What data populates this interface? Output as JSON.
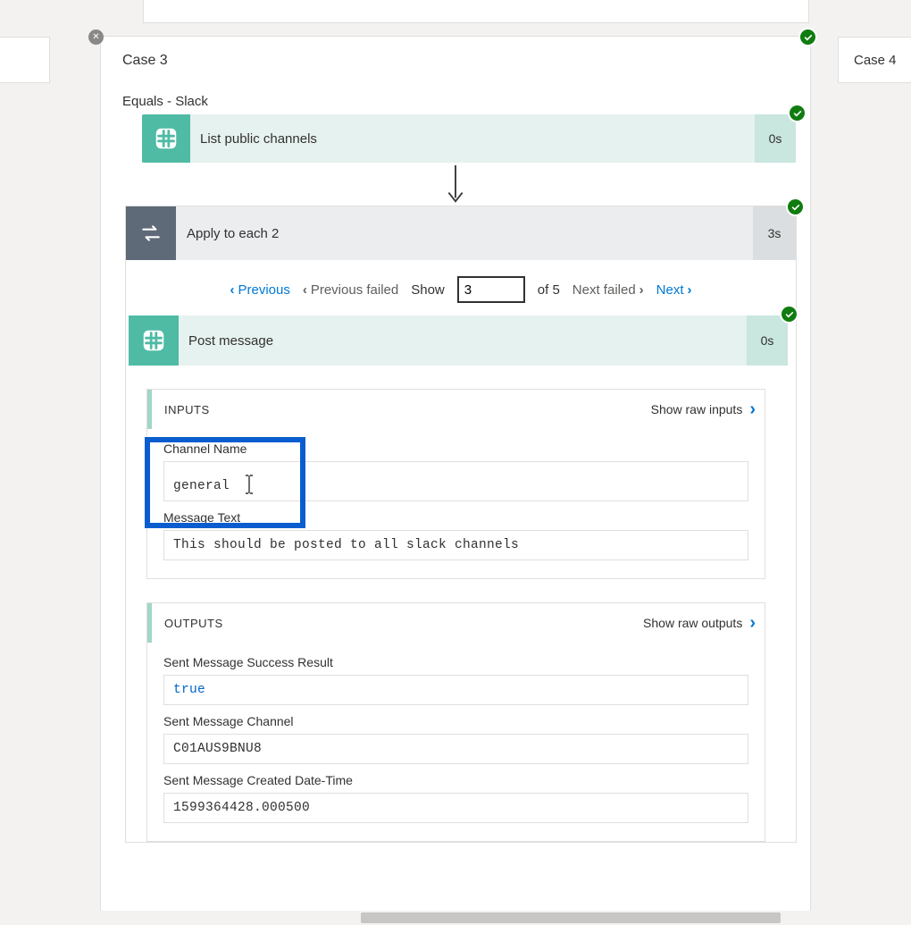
{
  "case_labels": {
    "case3": "Case 3",
    "case4": "Case 4"
  },
  "condition_label": "Equals - Slack",
  "steps": {
    "list_channels": {
      "label": "List public channels",
      "duration": "0s"
    },
    "apply_each": {
      "label": "Apply to each 2",
      "duration": "3s"
    },
    "post_message": {
      "label": "Post message",
      "duration": "0s"
    }
  },
  "pager": {
    "previous": "Previous",
    "previous_failed": "Previous failed",
    "show_label": "Show",
    "current": "3",
    "of_label": "of 5",
    "next_failed": "Next failed",
    "next": "Next"
  },
  "inputs": {
    "heading": "INPUTS",
    "raw_link": "Show raw inputs",
    "fields": {
      "channel_name": {
        "label": "Channel Name",
        "value": "general"
      },
      "message_text": {
        "label": "Message Text",
        "value": "This should be posted to all slack channels"
      }
    }
  },
  "outputs": {
    "heading": "OUTPUTS",
    "raw_link": "Show raw outputs",
    "fields": {
      "success": {
        "label": "Sent Message Success Result",
        "value": "true"
      },
      "channel": {
        "label": "Sent Message Channel",
        "value": "C01AUS9BNU8"
      },
      "created": {
        "label": "Sent Message Created Date-Time",
        "value": "1599364428.000500"
      }
    }
  }
}
